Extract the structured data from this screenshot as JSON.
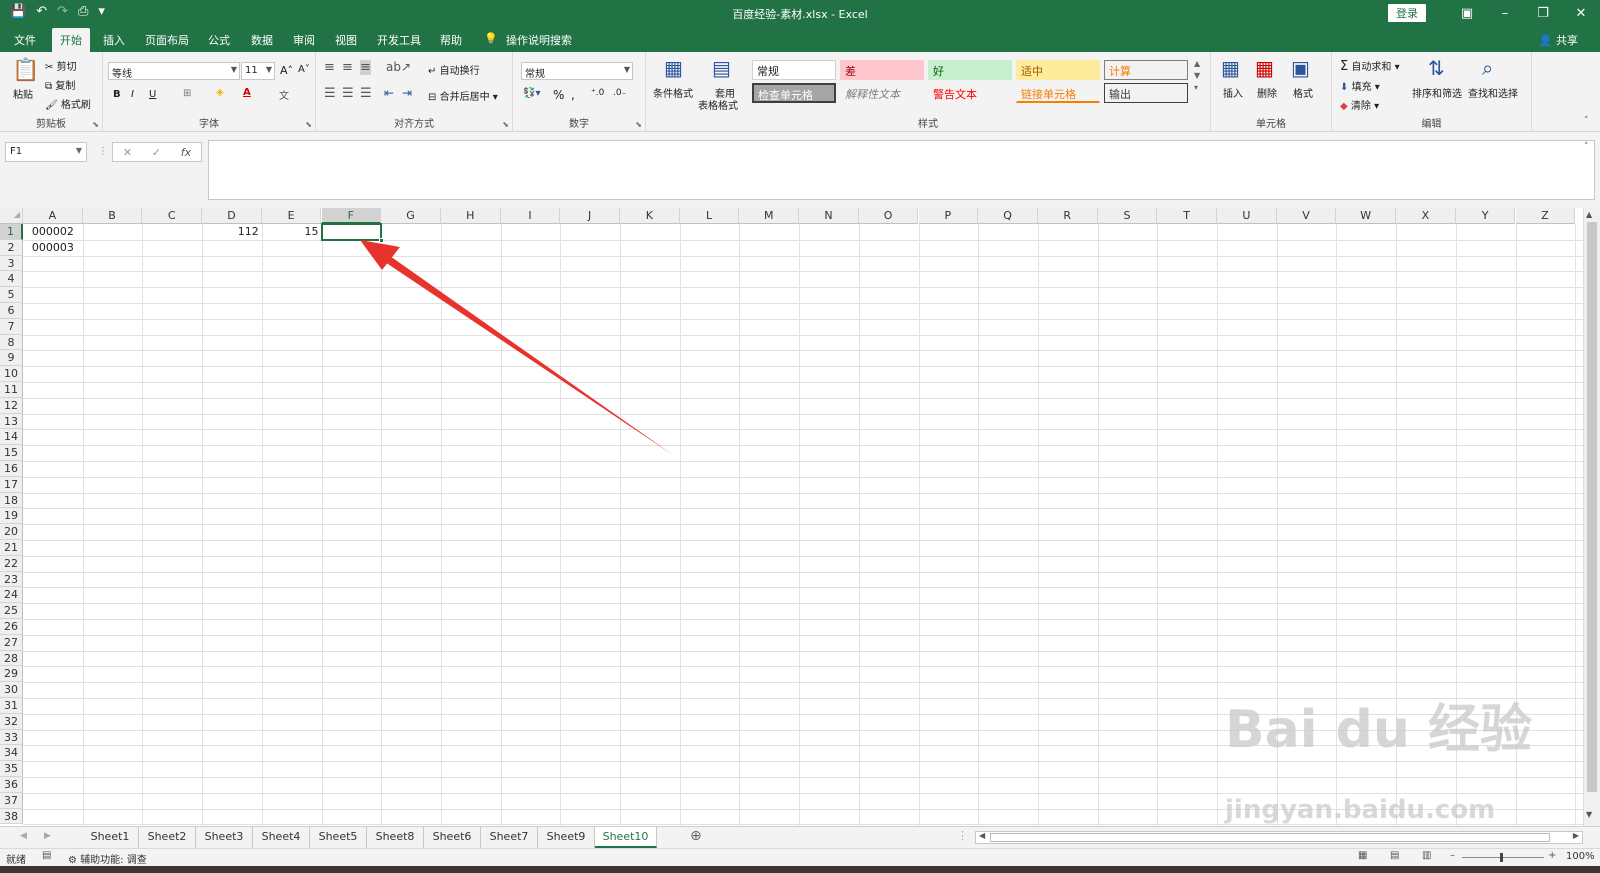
{
  "window": {
    "title": "百度经验-素材.xlsx  -  Excel",
    "login": "登录",
    "share": "共享"
  },
  "tabs": [
    "文件",
    "开始",
    "插入",
    "页面布局",
    "公式",
    "数据",
    "审阅",
    "视图",
    "开发工具",
    "帮助"
  ],
  "tell_me": "操作说明搜索",
  "ribbon": {
    "clipboard": {
      "label": "剪贴板",
      "paste": "粘贴",
      "cut": "剪切",
      "copy": "复制",
      "format_painter": "格式刷"
    },
    "font": {
      "label": "字体",
      "name": "等线",
      "size": "11",
      "bold": "B",
      "italic": "I",
      "underline": "U",
      "color_a": "A"
    },
    "alignment": {
      "label": "对齐方式",
      "wrap": "自动换行",
      "merge": "合并后居中"
    },
    "number": {
      "label": "数字",
      "format": "常规",
      "percent": "%"
    },
    "styles": {
      "label": "样式",
      "conditional": "条件格式",
      "table1": "套用",
      "table2": "表格格式",
      "items": [
        {
          "text": "常规",
          "bg": "#ffffff",
          "fg": "#222222"
        },
        {
          "text": "差",
          "bg": "#ffc7ce",
          "fg": "#9c0006"
        },
        {
          "text": "好",
          "bg": "#c6efce",
          "fg": "#006100"
        },
        {
          "text": "适中",
          "bg": "#ffeb9c",
          "fg": "#9c5700"
        },
        {
          "text": "计算",
          "bg": "#f2f2f2",
          "fg": "#fa7d00"
        },
        {
          "text": "检查单元格",
          "bg": "#a5a5a5",
          "fg": "#ffffff"
        },
        {
          "text": "解释性文本",
          "bg": "#f3f3f3",
          "fg": "#7f7f7f"
        },
        {
          "text": "警告文本",
          "bg": "#f3f3f3",
          "fg": "#ff0000"
        },
        {
          "text": "链接单元格",
          "bg": "#f3f3f3",
          "fg": "#fa7d00"
        },
        {
          "text": "输出",
          "bg": "#f2f2f2",
          "fg": "#3f3f3f"
        }
      ]
    },
    "cells": {
      "label": "单元格",
      "insert": "插入",
      "delete": "删除",
      "format": "格式"
    },
    "editing": {
      "label": "编辑",
      "autosum": "自动求和",
      "fill": "填充",
      "clear": "清除",
      "sort": "排序和筛选",
      "find": "查找和选择"
    }
  },
  "formula_bar": {
    "name_box": "F1",
    "cancel": "✕",
    "enter": "✓",
    "fx": "fx",
    "value": ""
  },
  "columns": [
    "A",
    "B",
    "C",
    "D",
    "E",
    "F",
    "G",
    "H",
    "I",
    "J",
    "K",
    "L",
    "M",
    "N",
    "O",
    "P",
    "Q",
    "R",
    "S",
    "T",
    "U",
    "V",
    "W",
    "X",
    "Y",
    "Z"
  ],
  "selected_column": "F",
  "selected_row": "1",
  "cells": [
    {
      "ref": "A1",
      "value": "000002"
    },
    {
      "ref": "A2",
      "value": "000003"
    },
    {
      "ref": "D1",
      "value": "112"
    },
    {
      "ref": "E1",
      "value": "15"
    }
  ],
  "sheets": [
    "Sheet1",
    "Sheet2",
    "Sheet3",
    "Sheet4",
    "Sheet5",
    "Sheet8",
    "Sheet6",
    "Sheet7",
    "Sheet9",
    "Sheet10"
  ],
  "active_sheet": "Sheet10",
  "status": {
    "ready": "就绪",
    "accessibility": "辅助功能: 调查",
    "zoom": "100%"
  },
  "watermark": {
    "line1": "Bai du 经验",
    "line2": "jingyan.baidu.com"
  },
  "colors": {
    "excel_green": "#217346",
    "arrow_red": "#e8322d"
  }
}
